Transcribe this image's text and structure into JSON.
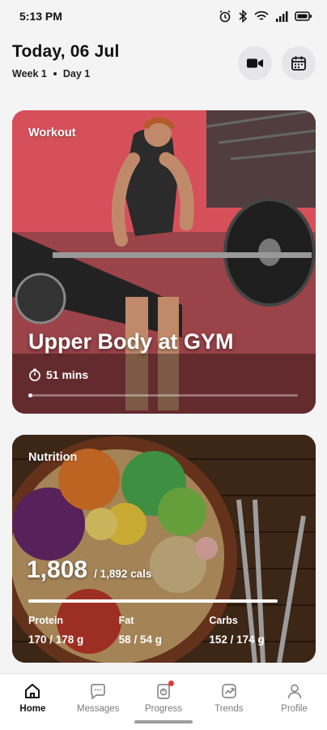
{
  "status_bar": {
    "time": "5:13 PM"
  },
  "header": {
    "date": "Today, 06 Jul",
    "week": "Week 1",
    "day": "Day 1",
    "video_icon": "video-camera-icon",
    "calendar_icon": "calendar-icon"
  },
  "workout": {
    "label": "Workout",
    "title": "Upper Body at GYM",
    "duration": "51 mins"
  },
  "nutrition": {
    "label": "Nutrition",
    "calories_consumed": "1,808",
    "calories_goal": "/ 1,892 cals",
    "calorie_fraction": 0.96,
    "macros": [
      {
        "label": "Protein",
        "value": "170",
        "goal": " / 178 g"
      },
      {
        "label": "Fat",
        "value": "58",
        "goal": " / 54 g"
      },
      {
        "label": "Carbs",
        "value": "152",
        "goal": " / 174 g"
      }
    ]
  },
  "tabs": [
    {
      "label": "Home",
      "icon": "home-icon",
      "active": true
    },
    {
      "label": "Messages",
      "icon": "chat-icon",
      "active": false
    },
    {
      "label": "Progress",
      "icon": "progress-icon",
      "active": false,
      "badge": true
    },
    {
      "label": "Trends",
      "icon": "trends-icon",
      "active": false
    },
    {
      "label": "Profile",
      "icon": "profile-icon",
      "active": false
    }
  ],
  "colors": {
    "accent": "#e53935",
    "card_workout": "#c63d48",
    "card_nutrition": "#4a2f1c"
  }
}
